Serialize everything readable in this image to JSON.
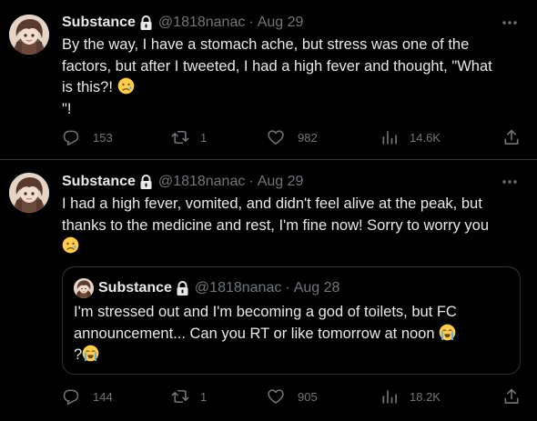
{
  "tweets": [
    {
      "author": {
        "name": "Substance",
        "handle": "@1818nanac"
      },
      "separator": "·",
      "date": "Aug 29",
      "text_line1": "By the way, I have a stomach ache, but stress was one of the",
      "text_line2": "factors, but after I tweeted, I had a high fever and thought, \"What",
      "text_line3": "is this?! ",
      "text_line4": "\"!",
      "stats": {
        "replies": "153",
        "retweets": "1",
        "likes": "982",
        "views": "14.6K"
      }
    },
    {
      "author": {
        "name": "Substance",
        "handle": "@1818nanac"
      },
      "separator": "·",
      "date": "Aug 29",
      "text_line1": "I had a high fever, vomited, and didn't feel alive at the peak, but",
      "text_line2": "thanks to the medicine and rest, I'm fine now! Sorry to worry you",
      "quote": {
        "author": {
          "name": "Substance",
          "handle": "@1818nanac"
        },
        "separator": "·",
        "date": "Aug 28",
        "text_line1": "I'm stressed out and I'm becoming a god of toilets, but FC",
        "text_line2": "announcement... Can you RT or like tomorrow at noon ",
        "text_line3": "?"
      },
      "stats": {
        "replies": "144",
        "retweets": "1",
        "likes": "905",
        "views": "18.2K"
      }
    }
  ],
  "icons": {
    "more": "more-icon",
    "lock": "lock-icon",
    "reply": "reply-icon",
    "retweet": "retweet-icon",
    "like": "heart-icon",
    "views": "views-icon",
    "share": "share-icon"
  },
  "colors": {
    "background": "#000000",
    "text": "#e7e9ea",
    "muted": "#71767b",
    "border": "#2f3336"
  }
}
